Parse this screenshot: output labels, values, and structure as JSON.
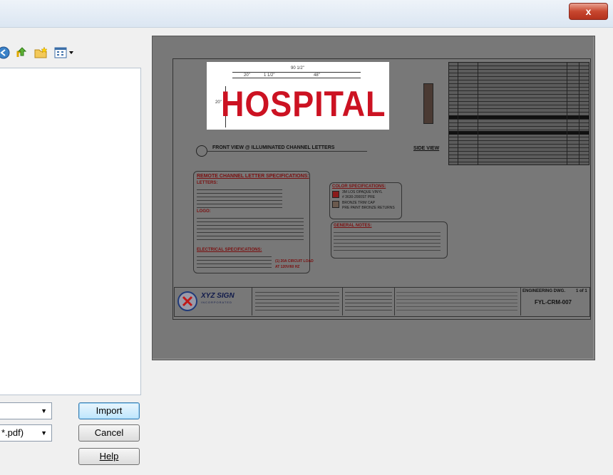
{
  "window": {
    "close_label": "x"
  },
  "toolbar": {
    "icons": [
      "back-icon",
      "up-folder-icon",
      "new-folder-icon",
      "view-menu-icon"
    ]
  },
  "filename_field": {
    "value": ""
  },
  "filetype_field": {
    "value": "*.pdf)"
  },
  "buttons": {
    "import": "Import",
    "cancel": "Cancel",
    "help": "Help"
  },
  "preview": {
    "sign_text": "HOSPITAL",
    "dimension_overall": "90 1/2\"",
    "dimension_a": "20\"",
    "dimension_b": "1 1/2\"",
    "dimension_c": "48\"",
    "dimension_height": "20\"",
    "front_view_label": "FRONT VIEW @ ILLUMINATED CHANNEL LETTERS",
    "side_view_label": "SIDE VIEW",
    "remote_spec_title": "REMOTE CHANNEL LETTER SPECIFICATIONS:",
    "letters_label": "LETTERS:",
    "logo_label": "LOGO:",
    "electrical_label": "ELECTRICAL SPECIFICATIONS:",
    "circuit_note": "(1) 20A CIRCUIT LOAD",
    "circuit_note2": "AT 120V/60 HZ",
    "color_spec_title": "COLOR SPECIFICATIONS:",
    "color_1": "3M LOS OPAQUE VINYL",
    "color_2": "# 3630-2000ST PRE",
    "color_3": "BRONZE TRIM CAP",
    "color_4": "PRE PAINT BRONZE RETURNS",
    "general_notes_title": "GENERAL NOTES:",
    "company_name": "XYZ SIGN",
    "company_sub": "INCORPORATED",
    "drawing_title": "ENGINEERING DWG.",
    "sheet": "1 of 1",
    "drawing_number": "FYL-CRM-007",
    "color_values": {
      "red": "#8b1a1a",
      "bronze": "#6b5a4e",
      "sign_red": "#cc1222"
    }
  }
}
